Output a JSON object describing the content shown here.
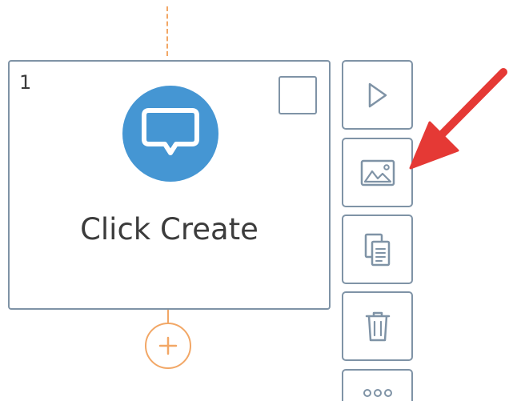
{
  "step": {
    "number": "1",
    "label": "Click Create",
    "icon": "chat-bubble-icon",
    "icon_color": "#4596d3"
  },
  "colors": {
    "border": "#7f93a6",
    "connector": "#f2a766",
    "arrow": "#e53935"
  },
  "actions": [
    {
      "name": "play",
      "icon": "play-icon"
    },
    {
      "name": "image",
      "icon": "image-icon"
    },
    {
      "name": "copy",
      "icon": "copy-icon"
    },
    {
      "name": "delete",
      "icon": "trash-icon"
    },
    {
      "name": "more",
      "icon": "more-icon"
    }
  ],
  "add_step_icon": "plus-icon",
  "annotation_icon": "red-arrow-icon"
}
